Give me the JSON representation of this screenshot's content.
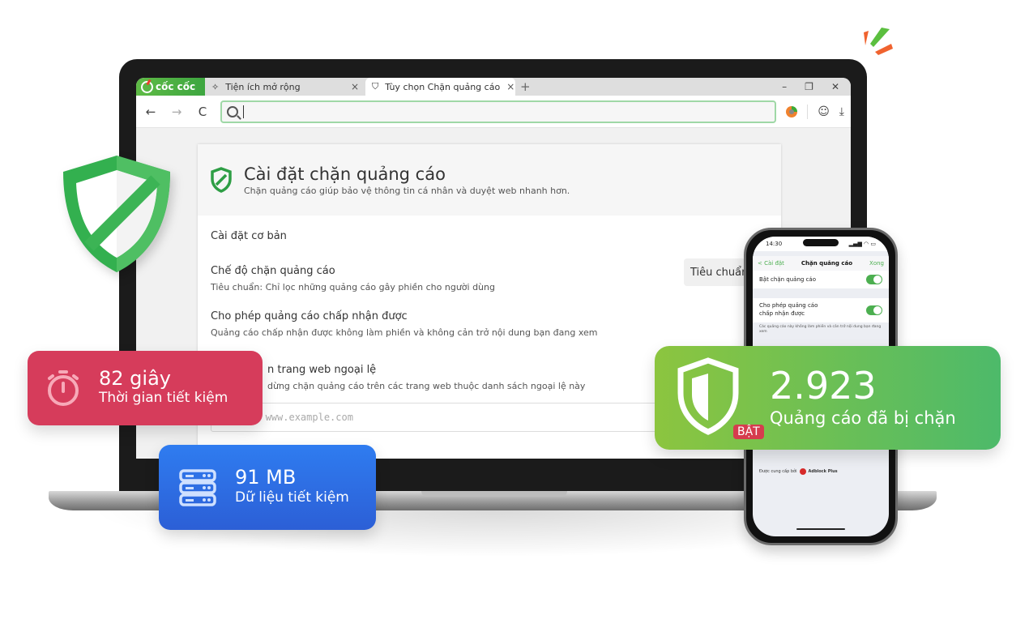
{
  "browser": {
    "brand_name": "cốc cốc",
    "tabs": [
      {
        "label": "Tiện ích mở rộng",
        "icon": "puzzle-icon"
      },
      {
        "label": "Tùy chọn Chặn quảng cáo",
        "icon": "shield-icon",
        "active": true
      }
    ],
    "new_tab_label": "+",
    "tab_close_label": "×",
    "window_controls": {
      "minimize": "–",
      "restore": "❐",
      "close": "✕"
    },
    "nav": {
      "back": "←",
      "forward": "→",
      "reload": "C"
    },
    "address_bar": {
      "value": "",
      "placeholder": ""
    },
    "toolbar_icons": {
      "profile": "☺",
      "download": "⤓"
    }
  },
  "settings": {
    "title": "Cài đặt chặn quảng cáo",
    "subtitle": "Chặn quảng cáo giúp bảo vệ thông tin cá nhân và duyệt web nhanh hơn.",
    "section_title": "Cài đặt cơ bản",
    "mode": {
      "title": "Chế độ chặn quảng cáo",
      "description": "Tiêu chuẩn: Chỉ lọc những quảng cáo gây phiền cho người dùng",
      "selected": "Tiêu chuẩn"
    },
    "acceptable_ads": {
      "title": "Cho phép quảng cáo chấp nhận được",
      "description": "Quảng cáo chấp nhận được không làm phiền và không cản trở nội dung bạn đang xem"
    },
    "exceptions": {
      "title_visible": "n trang web ngoại lệ",
      "description_visible": "dừng chặn quảng cáo trên các trang web thuộc danh sách ngoại lệ này",
      "input_placeholder": "ví dụ: www.example.com"
    }
  },
  "stats": {
    "time_saved": {
      "value": "82 giây",
      "label": "Thời gian tiết kiệm",
      "color": "#d63c5b"
    },
    "data_saved": {
      "value": "91 MB",
      "label": "Dữ liệu tiết kiệm",
      "color": "#2f6fe6"
    },
    "ads_blocked": {
      "value": "2.923",
      "label": "Quảng cáo đã bị chặn",
      "status_badge": "BẬT",
      "color": "#6cc04a"
    }
  },
  "phone": {
    "time": "14:30",
    "status_icons": "▂▄▆ ◠ ▭",
    "nav_back": "< Cài đặt",
    "nav_title": "Chặn quảng cáo",
    "nav_done": "Xong",
    "rows": [
      {
        "label": "Bật chặn quảng cáo",
        "toggle_on": true
      },
      {
        "label": "Cho phép quảng cáo chấp nhận được",
        "toggle_on": true
      }
    ],
    "note": "Các quảng cáo này không làm phiền và cản trở nội dung bạn đang xem",
    "provider_prefix": "Được cung cấp bởi",
    "provider_name": "Adblock Plus"
  }
}
